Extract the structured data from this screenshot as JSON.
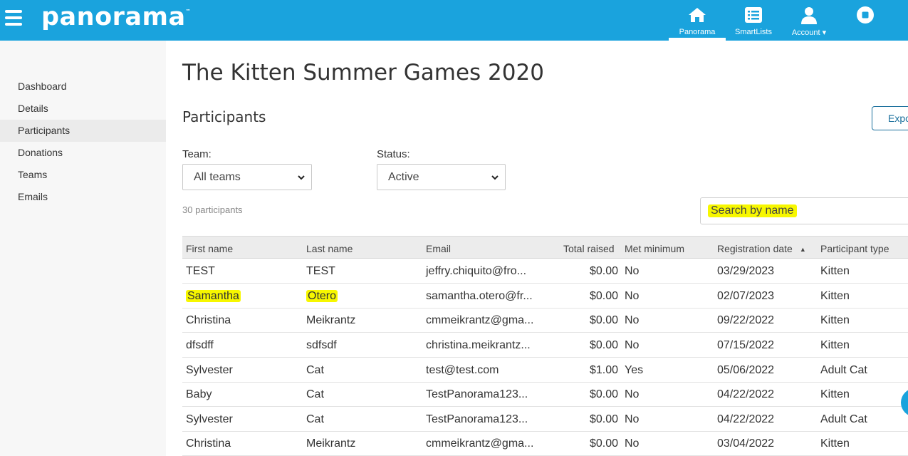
{
  "brand": {
    "logo_text": "panorama",
    "tm": "™"
  },
  "nav": [
    {
      "label": "Panorama",
      "icon": "home-icon",
      "active": true
    },
    {
      "label": "SmartLists",
      "icon": "list-icon",
      "active": false
    },
    {
      "label": "Account ▾",
      "icon": "user-icon",
      "active": false
    },
    {
      "label": "",
      "icon": "stop-icon",
      "active": false
    }
  ],
  "sidebar": {
    "items": [
      {
        "label": "Dashboard"
      },
      {
        "label": "Details"
      },
      {
        "label": "Participants",
        "active": true
      },
      {
        "label": "Donations"
      },
      {
        "label": "Teams"
      },
      {
        "label": "Emails"
      }
    ]
  },
  "page": {
    "title": "The Kitten Summer Games 2020",
    "section_title": "Participants",
    "export_label": "Export"
  },
  "filters": {
    "team_label": "Team:",
    "team_value": "All teams",
    "status_label": "Status:",
    "status_value": "Active"
  },
  "count_text": "30 participants",
  "search": {
    "placeholder": "Search by name"
  },
  "table": {
    "columns": [
      "First name",
      "Last name",
      "Email",
      "Total raised",
      "Met minimum",
      "Registration date",
      "Participant type"
    ],
    "rows": [
      [
        "TEST",
        "TEST",
        "jeffry.chiquito@fro...",
        "$0.00",
        "No",
        "03/29/2023",
        "Kitten"
      ],
      [
        "Samantha",
        "Otero",
        "samantha.otero@fr...",
        "$0.00",
        "No",
        "02/07/2023",
        "Kitten"
      ],
      [
        "Christina",
        "Meikrantz",
        "cmmeikrantz@gma...",
        "$0.00",
        "No",
        "09/22/2022",
        "Kitten"
      ],
      [
        "dfsdff",
        "sdfsdf",
        "christina.meikrantz...",
        "$0.00",
        "No",
        "07/15/2022",
        "Kitten"
      ],
      [
        "Sylvester",
        "Cat",
        "test@test.com",
        "$1.00",
        "Yes",
        "05/06/2022",
        "Adult Cat"
      ],
      [
        "Baby",
        "Cat",
        "TestPanorama123...",
        "$0.00",
        "No",
        "04/22/2022",
        "Kitten"
      ],
      [
        "Sylvester",
        "Cat",
        "TestPanorama123...",
        "$0.00",
        "No",
        "04/22/2022",
        "Adult Cat"
      ],
      [
        "Christina",
        "Meikrantz",
        "cmmeikrantz@gma...",
        "$0.00",
        "No",
        "03/04/2022",
        "Kitten"
      ]
    ]
  },
  "colors": {
    "brand_blue": "#1aa3dd",
    "highlight": "#f7f700",
    "export_border": "#1a6f9c"
  }
}
